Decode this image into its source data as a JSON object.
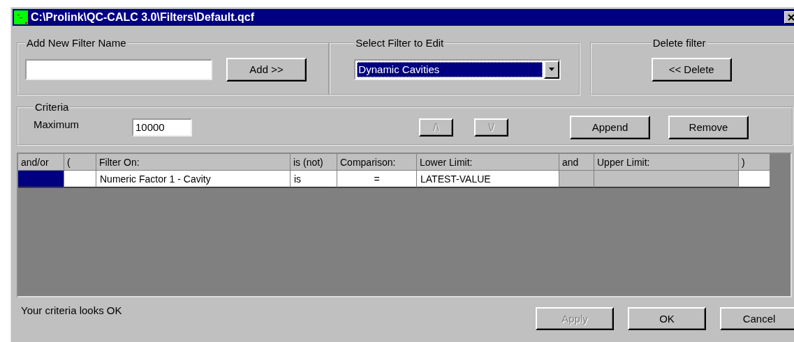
{
  "window": {
    "title": "C:\\Prolink\\QC-CALC 3.0\\Filters\\Default.qcf"
  },
  "add_filter": {
    "label": "Add New Filter Name",
    "button": {
      "label": "Add >>",
      "disabled": false
    }
  },
  "select_filter": {
    "label": "Select Filter to Edit",
    "value": "Dynamic Cavities",
    "focused": true
  },
  "delete_filter": {
    "label": "Delete filter",
    "button": {
      "label": "<< Delete",
      "disabled": false
    }
  },
  "criteria": {
    "label": "Criteria",
    "maximum_label": "Maximum",
    "maximum_value": "10000",
    "buttons": [
      {
        "label": "/\\",
        "disabled": true
      },
      {
        "label": "\\/",
        "disabled": true
      },
      {
        "label": "Append",
        "disabled": false
      },
      {
        "label": "Remove",
        "disabled": false
      }
    ]
  },
  "table": {
    "columns": [
      "and/or",
      "(",
      "Filter On:",
      "is (not)",
      "Comparison:",
      "Lower Limit:",
      "and",
      "Upper Limit:",
      ")"
    ],
    "rows": [
      {
        "cells": [
          {
            "selected": true,
            "disabled": false
          },
          {
            "selected": false,
            "disabled": false
          },
          {
            "text": "Numeric Factor 1 - Cavity",
            "selected": false,
            "disabled": false
          },
          {
            "text": "is",
            "selected": false,
            "disabled": false
          },
          {
            "text": "=",
            "selected": false,
            "disabled": false
          },
          {
            "text": "LATEST-VALUE",
            "selected": false,
            "disabled": false
          },
          {
            "selected": false,
            "disabled": true
          },
          {
            "selected": false,
            "disabled": true
          },
          {
            "selected": false,
            "disabled": false
          }
        ]
      }
    ]
  },
  "status": "Your criteria looks OK",
  "buttons": [
    {
      "label": "Apply",
      "disabled": true
    },
    {
      "label": "OK",
      "disabled": false
    },
    {
      "label": "Cancel",
      "disabled": false
    }
  ]
}
